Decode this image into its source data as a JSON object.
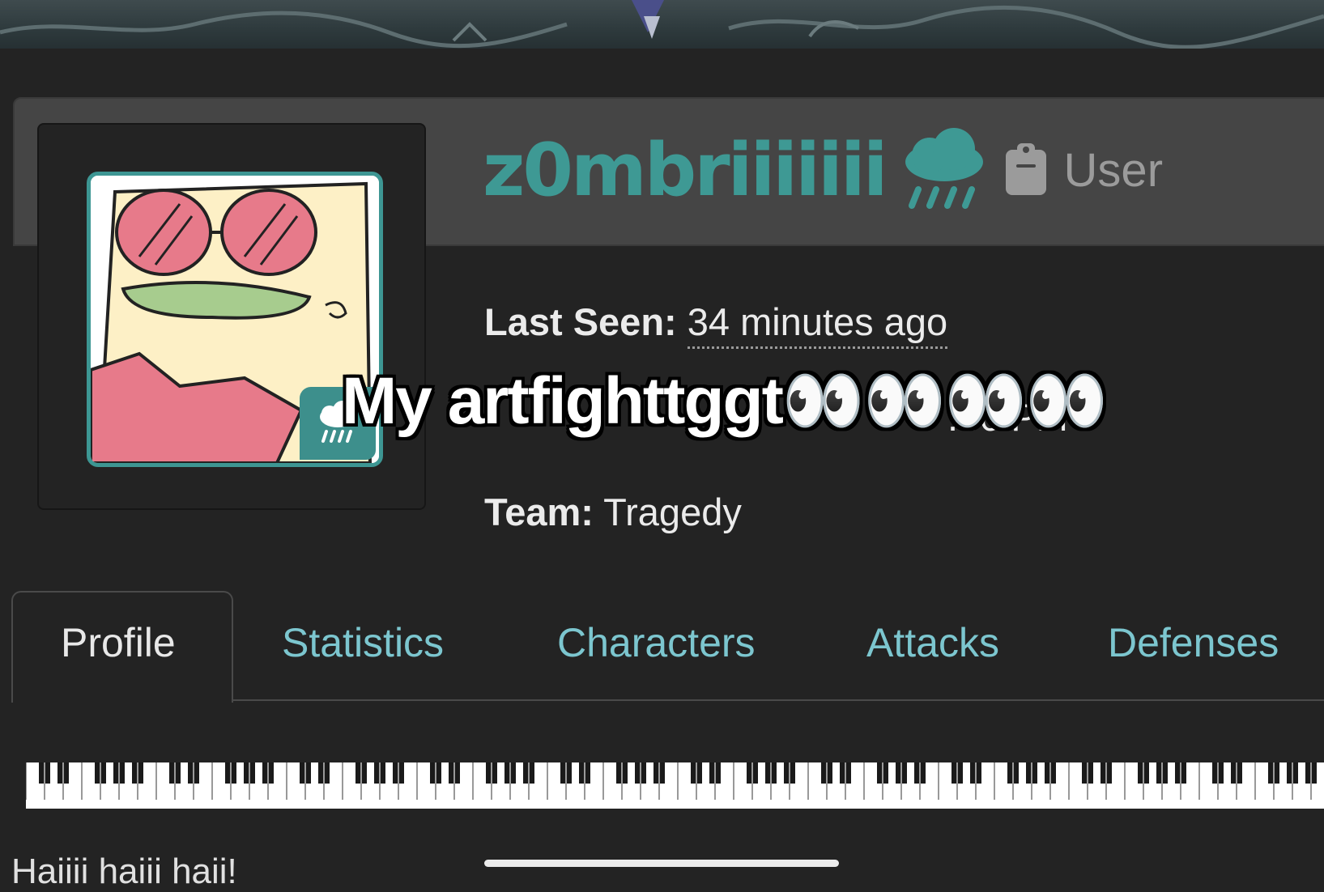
{
  "profile": {
    "username": "z0mbriiiiiii",
    "role": "User",
    "last_seen_label": "Last Seen:",
    "last_seen_value": "34 minutes ago",
    "joined_value_partial": ":46 PM",
    "team_label": "Team:",
    "team_value": "Tragedy"
  },
  "overlay": {
    "caption": "My artfighttggt👀👀👀👀"
  },
  "tabs": [
    {
      "label": "Profile",
      "active": true
    },
    {
      "label": "Statistics",
      "active": false
    },
    {
      "label": "Characters",
      "active": false
    },
    {
      "label": "Attacks",
      "active": false
    },
    {
      "label": "Defenses",
      "active": false
    }
  ],
  "bio": {
    "first_line": "Haiiii haiii haii!"
  },
  "icons": {
    "team_icon": "cloud-rain-icon",
    "role_icon": "clipboard-icon"
  },
  "colors": {
    "accent": "#3e9994",
    "tab_link": "#7cc6cf",
    "background": "#232323"
  }
}
